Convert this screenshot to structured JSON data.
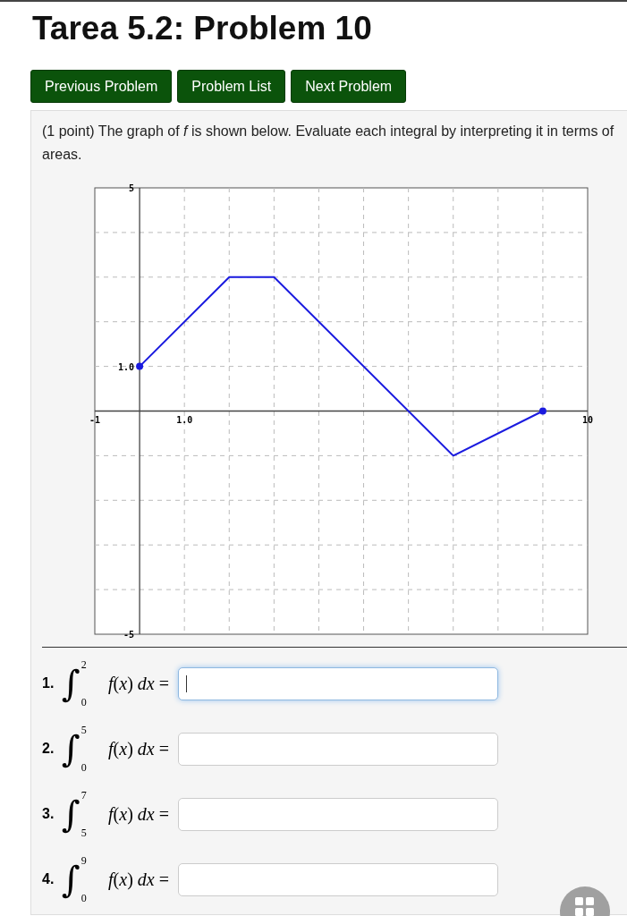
{
  "title": "Tarea 5.2: Problem 10",
  "nav_buttons": [
    "Previous Problem",
    "Problem List",
    "Next Problem"
  ],
  "problem": {
    "prompt": "(1 point) The graph of *f* is shown below. Evaluate each integral by interpreting it in terms of areas.",
    "chart_data": {
      "type": "line",
      "x": [
        0,
        2,
        3,
        7,
        9
      ],
      "series": [
        {
          "color": "#1a1adf",
          "values": [
            1,
            3,
            3,
            -1,
            0
          ]
        }
      ],
      "xlim": [
        -1,
        10
      ],
      "ylim": [
        -5,
        5
      ],
      "xticks": [
        {
          "value": -1,
          "label": "-1"
        },
        {
          "value": 1,
          "label": "1.0"
        },
        {
          "value": 10,
          "label": "10"
        }
      ],
      "yticks": [
        {
          "value": -5,
          "label": "-5"
        },
        {
          "value": 1,
          "label": "1.0"
        },
        {
          "value": 5,
          "label": "5"
        }
      ]
    },
    "questions": [
      {
        "number": "1.",
        "integral": "∫",
        "lower": "0",
        "upper": "2",
        "integrand": "*f*(*x*) *dx* =",
        "focused": true
      },
      {
        "number": "2.",
        "integral": "∫",
        "lower": "0",
        "upper": "5",
        "integrand": "*f*(*x*) *dx* =",
        "focused": false
      },
      {
        "number": "3.",
        "integral": "∫",
        "lower": "5",
        "upper": "7",
        "integrand": "*f*(*x*) *dx* =",
        "focused": false
      },
      {
        "number": "4.",
        "integral": "∫",
        "lower": "0",
        "upper": "9",
        "integrand": "*f*(*x*) *dx* =",
        "focused": false
      }
    ]
  }
}
